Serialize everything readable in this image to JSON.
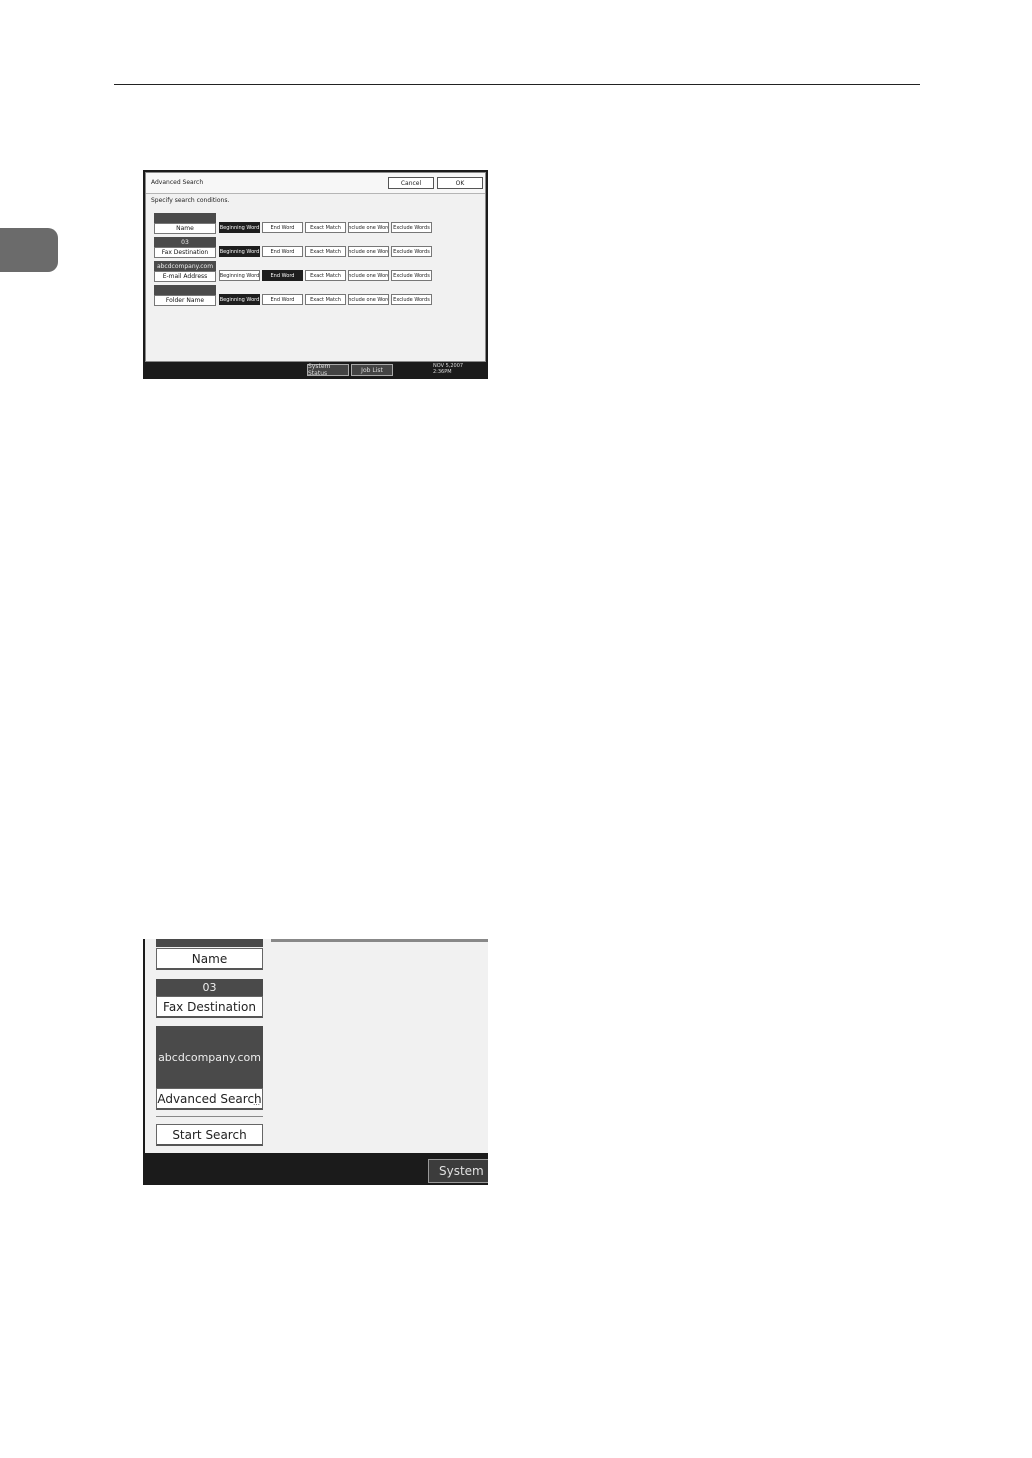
{
  "screen1": {
    "title": "Advanced Search",
    "cancel": "Cancel",
    "ok": "OK",
    "instruction": "Specify search conditions.",
    "fields": [
      {
        "value": "",
        "label": "Name",
        "selected": 0
      },
      {
        "value": "03",
        "label": "Fax Destination",
        "selected": 0
      },
      {
        "value": "abcdcompany.com",
        "label": "E-mail Address",
        "selected": 1
      },
      {
        "value": "",
        "label": "Folder Name",
        "selected": 0
      }
    ],
    "options": [
      "Beginning Word",
      "End Word",
      "Exact Match",
      "Include one Word",
      "Exclude Words"
    ],
    "system_status": "System Status",
    "job_list": "Job List",
    "clock_line1": "NOV 5,2007",
    "clock_line2": "2:36PM"
  },
  "screen2": {
    "name_label": "Name",
    "fax_value": "03",
    "fax_label": "Fax Destination",
    "email_value": "abcdcompany.com",
    "advanced_search": "Advanced Search",
    "start_search": "Start Search",
    "system_status": "System Statu"
  }
}
